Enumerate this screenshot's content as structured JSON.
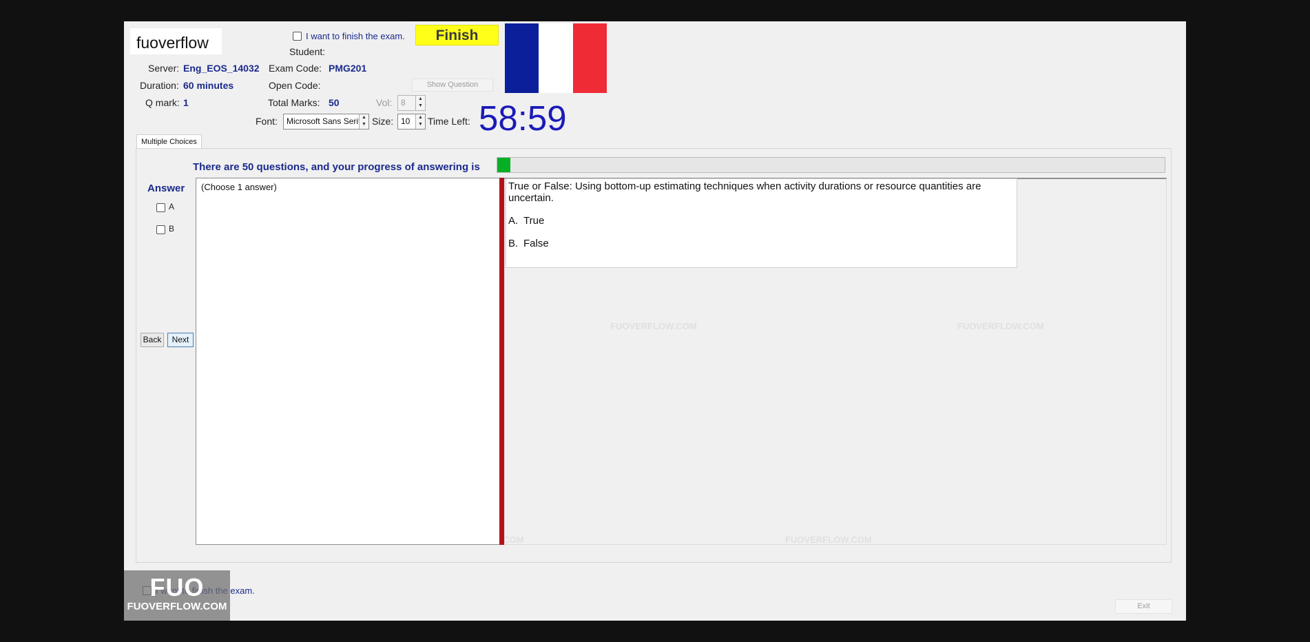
{
  "header": {
    "logo_text": "fuoverflow",
    "finish_checkbox_label": "I want to finish the exam.",
    "finish_button": "Finish",
    "student_label": "Student:",
    "server_label": "Server:",
    "server_value": "Eng_EOS_14032",
    "exam_code_label": "Exam Code:",
    "exam_code_value": "PMG201",
    "duration_label": "Duration:",
    "duration_value": "60 minutes",
    "open_code_label": "Open Code:",
    "show_question_button": "Show Question",
    "qmark_label": "Q mark:",
    "qmark_value": "1",
    "total_marks_label": "Total Marks:",
    "total_marks_value": "50",
    "vol_label": "Vol:",
    "vol_value": "8",
    "font_label": "Font:",
    "font_value": "Microsoft Sans Serif",
    "size_label": "Size:",
    "size_value": "10",
    "time_left_label": "Time Left:",
    "time_left_value": "58:59"
  },
  "flag_colors": [
    "#0b1f9b",
    "#ffffff",
    "#ef2b36"
  ],
  "tabs": [
    {
      "label": "Multiple Choices"
    }
  ],
  "progress": {
    "label": "There are 50 questions, and your progress of answering is",
    "fraction": 0.02,
    "color": "#06b025"
  },
  "answer": {
    "title": "Answer",
    "options": [
      {
        "label": "A",
        "checked": false
      },
      {
        "label": "B",
        "checked": false
      }
    ],
    "panel_text": "(Choose 1 answer)"
  },
  "navigation": {
    "back": "Back",
    "next": "Next"
  },
  "question": {
    "text": "True or False: Using bottom-up estimating techniques when activity durations or resource quantities are uncertain.",
    "options": [
      {
        "letter": "A.",
        "text": "True"
      },
      {
        "letter": "B.",
        "text": "False"
      }
    ]
  },
  "footer": {
    "finish_checkbox_label": "I want to finish the exam.",
    "exit_button": "Exit"
  },
  "watermark": {
    "badge_big": "FUO",
    "badge_small": "FUOVERFLOW.COM",
    "faint_text": "FUOVERFLOW.COM"
  }
}
